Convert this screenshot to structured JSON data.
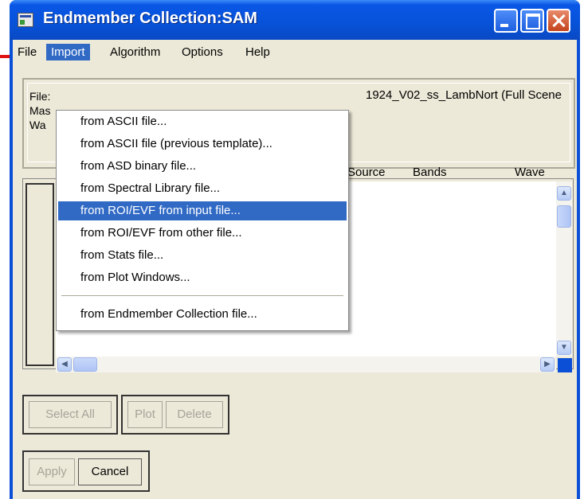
{
  "window": {
    "title": "Endmember Collection:SAM"
  },
  "menubar": [
    {
      "label": "File"
    },
    {
      "label": "Import"
    },
    {
      "label": "Algorithm"
    },
    {
      "label": "Options"
    },
    {
      "label": "Help"
    }
  ],
  "import_menu": {
    "items": [
      "from ASCII file...",
      "from ASCII file (previous template)...",
      "from ASD binary file...",
      "from Spectral Library file...",
      "from ROI/EVF from input file...",
      "from ROI/EVF from other file...",
      "from Stats file...",
      "from Plot Windows...",
      "from Endmember Collection file..."
    ],
    "highlighted": "from ROI/EVF from input file..."
  },
  "info": {
    "lines": [
      "File:",
      "Mas",
      "Wa"
    ],
    "file_value": "1924_V02_ss_LambNort (Full Scene"
  },
  "list": {
    "columns": [
      "Source",
      "Bands",
      "Wave"
    ]
  },
  "buttons": {
    "select_all": "Select All",
    "plot": "Plot",
    "delete": "Delete",
    "apply": "Apply",
    "cancel": "Cancel"
  },
  "colors": {
    "titlebar": "#0a57e6",
    "highlight": "#316ac5",
    "arrow": "#e01010"
  }
}
